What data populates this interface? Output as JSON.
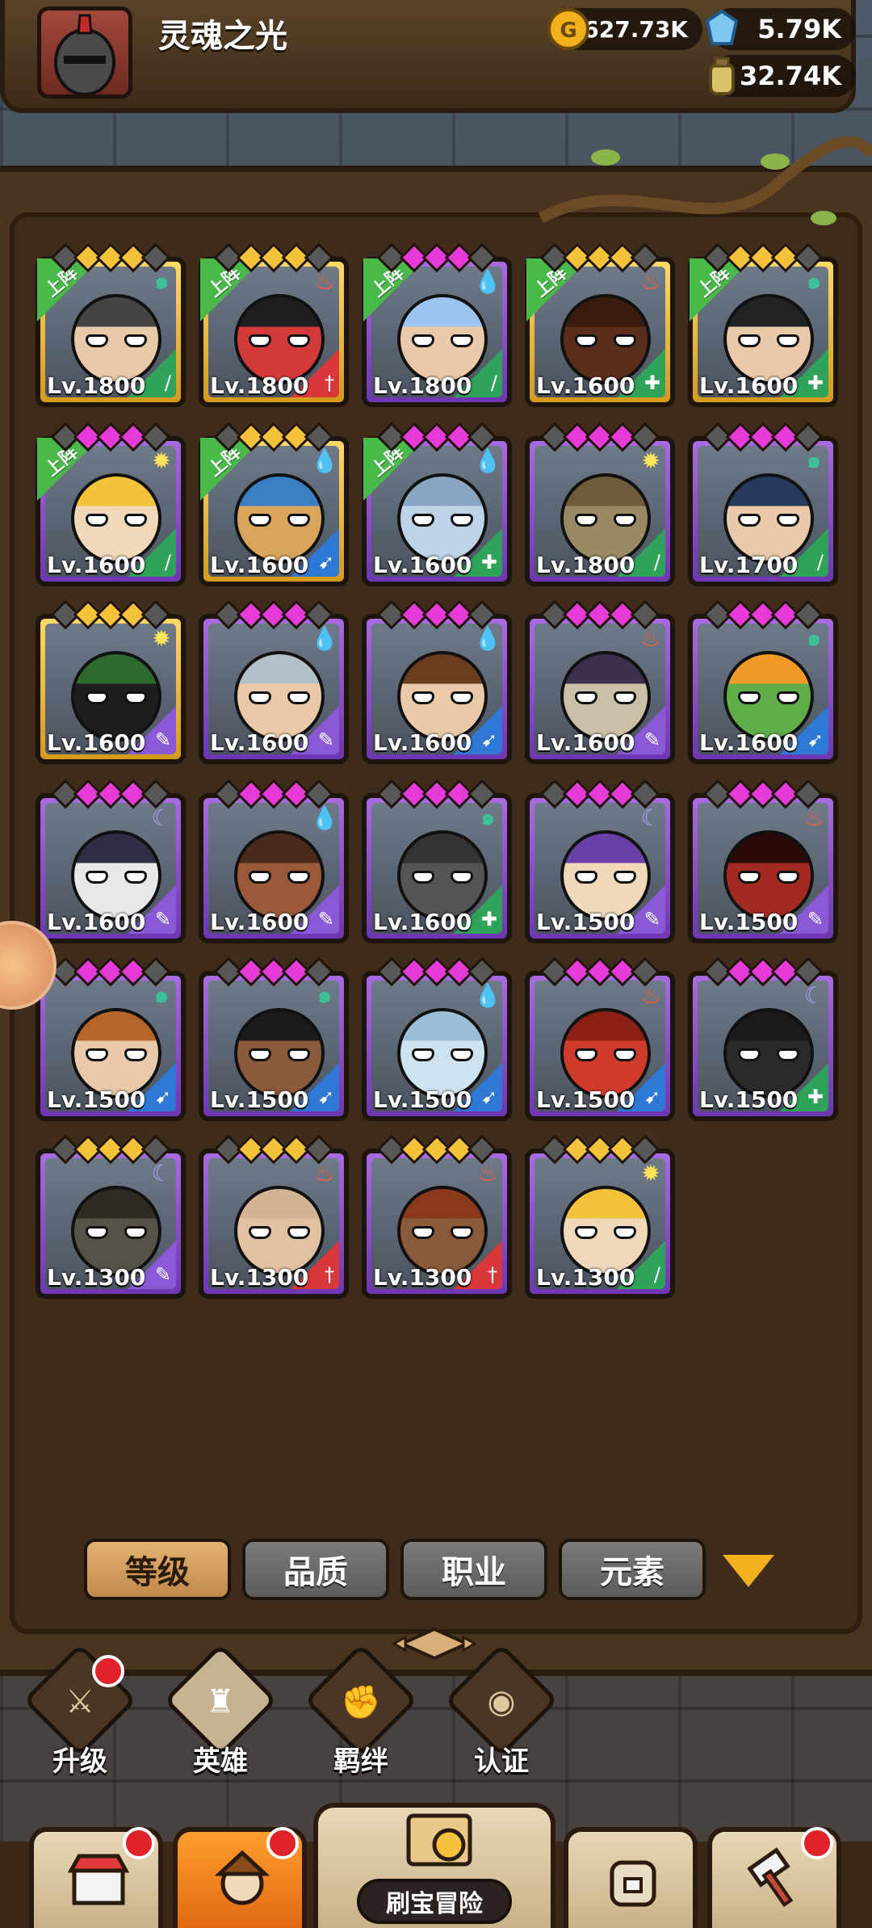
{
  "player": {
    "name": "灵魂之光"
  },
  "resources": {
    "gold": "627.73K",
    "gems": "5.79K",
    "potion": "32.74K"
  },
  "badge_label": "上阵",
  "heroes": [
    {
      "level": "Lv.1800",
      "rarity": "gold",
      "stars": "gold",
      "element": "wind",
      "role": "sword",
      "deployed": true,
      "skin": "#e9c9a8",
      "hair": "#444"
    },
    {
      "level": "Lv.1800",
      "rarity": "gold",
      "stars": "gold",
      "element": "fire",
      "role": "dagger",
      "deployed": true,
      "skin": "#d33a3a",
      "hair": "#1f1f1f"
    },
    {
      "level": "Lv.1800",
      "rarity": "purple",
      "stars": "on",
      "element": "water",
      "role": "sword",
      "deployed": true,
      "skin": "#e9c9a8",
      "hair": "#9bc4f0"
    },
    {
      "level": "Lv.1600",
      "rarity": "gold",
      "stars": "gold",
      "element": "fire",
      "role": "shield",
      "deployed": true,
      "skin": "#5a2e1a",
      "hair": "#3a1b10"
    },
    {
      "level": "Lv.1600",
      "rarity": "gold",
      "stars": "gold",
      "element": "wind",
      "role": "shield",
      "deployed": true,
      "skin": "#e9c9a8",
      "hair": "#222"
    },
    {
      "level": "Lv.1600",
      "rarity": "purple",
      "stars": "on",
      "element": "light",
      "role": "sword",
      "deployed": true,
      "skin": "#f0d8b8",
      "hair": "#f5c33a"
    },
    {
      "level": "Lv.1600",
      "rarity": "gold",
      "stars": "gold",
      "element": "water",
      "role": "bow",
      "deployed": true,
      "skin": "#d9a55a",
      "hair": "#3a7ec4"
    },
    {
      "level": "Lv.1600",
      "rarity": "purple",
      "stars": "on",
      "element": "water",
      "role": "shield",
      "deployed": true,
      "skin": "#bcd3e8",
      "hair": "#8aa5bf"
    },
    {
      "level": "Lv.1800",
      "rarity": "purple",
      "stars": "on",
      "element": "light",
      "role": "sword",
      "deployed": false,
      "skin": "#9a8a64",
      "hair": "#6e5c3a"
    },
    {
      "level": "Lv.1700",
      "rarity": "purple",
      "stars": "on",
      "element": "wind",
      "role": "sword",
      "deployed": false,
      "skin": "#e9c9a8",
      "hair": "#263a5e"
    },
    {
      "level": "Lv.1600",
      "rarity": "gold",
      "stars": "gold",
      "element": "light",
      "role": "staff",
      "deployed": false,
      "skin": "#1d1d1d",
      "hair": "#2d6a2d"
    },
    {
      "level": "Lv.1600",
      "rarity": "purple",
      "stars": "on",
      "element": "water",
      "role": "staff",
      "deployed": false,
      "skin": "#e9c9a8",
      "hair": "#b4c0c8"
    },
    {
      "level": "Lv.1600",
      "rarity": "purple",
      "stars": "on",
      "element": "water",
      "role": "bow",
      "deployed": false,
      "skin": "#e9c9a8",
      "hair": "#6b3d1f"
    },
    {
      "level": "Lv.1600",
      "rarity": "purple",
      "stars": "on",
      "element": "fire",
      "role": "staff",
      "deployed": false,
      "skin": "#c9c0a6",
      "hair": "#3b2f4d"
    },
    {
      "level": "Lv.1600",
      "rarity": "purple",
      "stars": "on",
      "element": "wind",
      "role": "bow",
      "deployed": false,
      "skin": "#5fae4a",
      "hair": "#f09a2a"
    },
    {
      "level": "Lv.1600",
      "rarity": "purple",
      "stars": "on",
      "element": "dark",
      "role": "staff",
      "deployed": false,
      "skin": "#e8e8e8",
      "hair": "#2d2f45"
    },
    {
      "level": "Lv.1600",
      "rarity": "purple",
      "stars": "on",
      "element": "water",
      "role": "staff",
      "deployed": false,
      "skin": "#9a5a3a",
      "hair": "#4a2a1a"
    },
    {
      "level": "Lv.1600",
      "rarity": "purple",
      "stars": "on",
      "element": "wind",
      "role": "shield",
      "deployed": false,
      "skin": "#555",
      "hair": "#333"
    },
    {
      "level": "Lv.1500",
      "rarity": "purple",
      "stars": "on",
      "element": "dark",
      "role": "staff",
      "deployed": false,
      "skin": "#f0d8b8",
      "hair": "#6a3fa8"
    },
    {
      "level": "Lv.1500",
      "rarity": "purple",
      "stars": "on",
      "element": "fire",
      "role": "staff",
      "deployed": false,
      "skin": "#a32a22",
      "hair": "#2a0a08"
    },
    {
      "level": "Lv.1500",
      "rarity": "purple",
      "stars": "on",
      "element": "wind",
      "role": "bow",
      "deployed": false,
      "skin": "#e9c9a8",
      "hair": "#b5652a"
    },
    {
      "level": "Lv.1500",
      "rarity": "purple",
      "stars": "on",
      "element": "wind",
      "role": "bow",
      "deployed": false,
      "skin": "#8a5a3a",
      "hair": "#1a1a1a"
    },
    {
      "level": "Lv.1500",
      "rarity": "purple",
      "stars": "on",
      "element": "water",
      "role": "bow",
      "deployed": false,
      "skin": "#cde3f0",
      "hair": "#9bbfd6"
    },
    {
      "level": "Lv.1500",
      "rarity": "purple",
      "stars": "on",
      "element": "fire",
      "role": "bow",
      "deployed": false,
      "skin": "#d03b2c",
      "hair": "#8a2015"
    },
    {
      "level": "Lv.1500",
      "rarity": "purple",
      "stars": "on",
      "element": "dark",
      "role": "shield",
      "deployed": false,
      "skin": "#2a2a2a",
      "hair": "#1a1a1a"
    },
    {
      "level": "Lv.1300",
      "rarity": "purple",
      "stars": "gold",
      "element": "dark",
      "role": "staff",
      "deployed": false,
      "skin": "#55524a",
      "hair": "#2e2a24"
    },
    {
      "level": "Lv.1300",
      "rarity": "purple",
      "stars": "gold",
      "element": "fire",
      "role": "dagger",
      "deployed": false,
      "skin": "#e0c2a2",
      "hair": "#d2b393"
    },
    {
      "level": "Lv.1300",
      "rarity": "purple",
      "stars": "gold",
      "element": "fire",
      "role": "dagger",
      "deployed": false,
      "skin": "#8a5a3a",
      "hair": "#8a3a1a"
    },
    {
      "level": "Lv.1300",
      "rarity": "purple",
      "stars": "gold",
      "element": "light",
      "role": "sword",
      "deployed": false,
      "skin": "#f0d8b8",
      "hair": "#f5c33a"
    }
  ],
  "element_colors": {
    "wind": "#3cc29a",
    "fire": "#ff5a3c",
    "water": "#3a8ef0",
    "light": "#ffe45a",
    "dark": "#b49cff"
  },
  "role_colors": {
    "sword": "#2fa35a",
    "dagger": "#d8383a",
    "shield": "#2fa35a",
    "bow": "#2f78d6",
    "staff": "#8a5ad6"
  },
  "filters": {
    "tabs": [
      "等级",
      "品质",
      "职业",
      "元素"
    ],
    "active_index": 0
  },
  "subnav": [
    {
      "label": "升级",
      "icon": "sword-upgrade-icon",
      "notify": true,
      "active": false
    },
    {
      "label": "英雄",
      "icon": "hero-silhouette-icon",
      "notify": false,
      "active": true
    },
    {
      "label": "羁绊",
      "icon": "fist-bond-icon",
      "notify": false,
      "active": false
    },
    {
      "label": "认证",
      "icon": "eye-certify-icon",
      "notify": false,
      "active": false
    }
  ],
  "bottom_nav": {
    "adventure_label": "刷宝冒险",
    "items": [
      {
        "icon": "shop-icon",
        "notify": true,
        "active": false
      },
      {
        "icon": "hero-portrait-icon",
        "notify": true,
        "active": true
      },
      {
        "icon": "backpack-icon",
        "notify": false,
        "active": false
      },
      {
        "icon": "forge-hammer-icon",
        "notify": true,
        "active": false
      }
    ]
  }
}
